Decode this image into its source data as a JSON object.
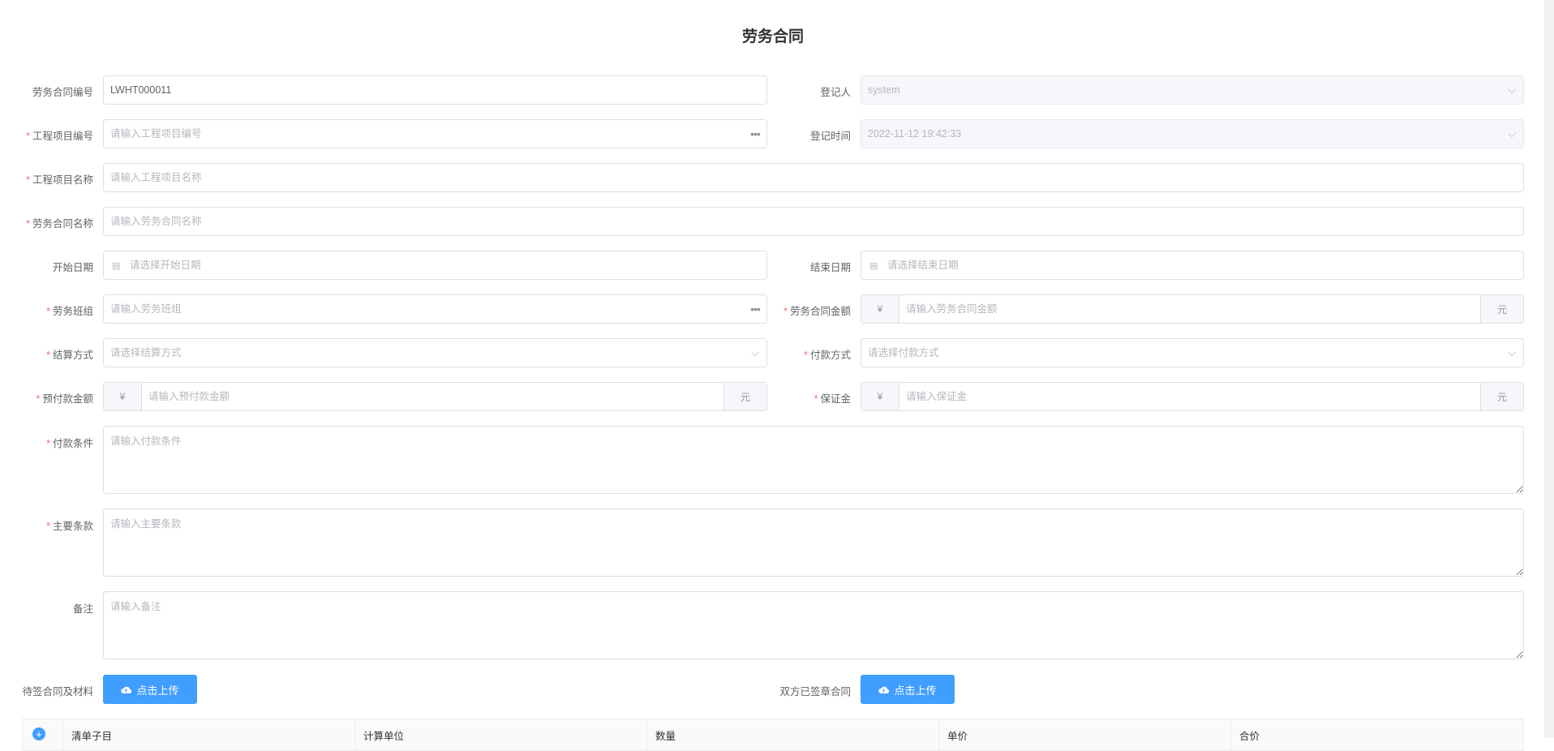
{
  "page_title": "劳务合同",
  "fields": {
    "contract_no": {
      "label": "劳务合同编号",
      "value": "LWHT000011"
    },
    "registrant": {
      "label": "登记人",
      "value": "system"
    },
    "project_no": {
      "label": "工程项目编号",
      "placeholder": "请输入工程项目编号"
    },
    "register_time": {
      "label": "登记时间",
      "value": "2022-11-12 19:42:33"
    },
    "project_name": {
      "label": "工程项目名称",
      "placeholder": "请输入工程项目名称"
    },
    "contract_name": {
      "label": "劳务合同名称",
      "placeholder": "请输入劳务合同名称"
    },
    "start_date": {
      "label": "开始日期",
      "placeholder": "请选择开始日期"
    },
    "end_date": {
      "label": "结束日期",
      "placeholder": "请选择结束日期"
    },
    "team": {
      "label": "劳务班组",
      "placeholder": "请输入劳务班组"
    },
    "amount": {
      "label": "劳务合同金额",
      "placeholder": "请输入劳务合同金额",
      "prefix": "¥",
      "suffix": "元"
    },
    "settlement": {
      "label": "结算方式",
      "placeholder": "请选择结算方式"
    },
    "payment_method": {
      "label": "付款方式",
      "placeholder": "请选择付款方式"
    },
    "prepay": {
      "label": "预付款金额",
      "placeholder": "请输入预付款金额",
      "prefix": "¥",
      "suffix": "元"
    },
    "deposit": {
      "label": "保证金",
      "placeholder": "请输入保证金",
      "prefix": "¥",
      "suffix": "元"
    },
    "payment_terms": {
      "label": "付款条件",
      "placeholder": "请输入付款条件"
    },
    "main_terms": {
      "label": "主要条款",
      "placeholder": "请输入主要条款"
    },
    "remark": {
      "label": "备注",
      "placeholder": "请输入备注"
    },
    "pending_materials": {
      "label": "待签合同及材料",
      "button": "点击上传"
    },
    "signed_contract": {
      "label": "双方已签章合同",
      "button": "点击上传"
    }
  },
  "required_mark": "*",
  "table": {
    "columns": [
      "清单子目",
      "计算单位",
      "数量",
      "单价",
      "合价"
    ]
  },
  "colors": {
    "primary": "#409eff",
    "required": "#f56c6c",
    "border": "#dcdfe6"
  }
}
